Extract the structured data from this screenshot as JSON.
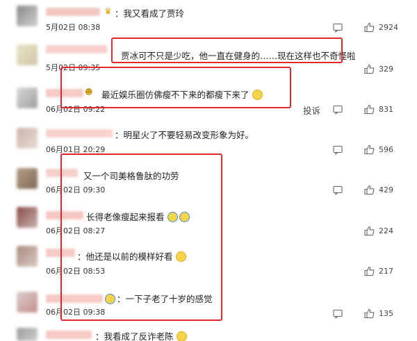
{
  "comments": [
    {
      "text": "：我又看成了贾玲",
      "time": "5月02日 08:38",
      "likes": "2924"
    },
    {
      "text": "贾冰可不只是少吃，他一直在健身的……现在这样也不奇怪啦",
      "time": "5月02日 09:35",
      "likes": "329"
    },
    {
      "text": "最近娱乐圈仿佛瘦不下来的都瘦下来了",
      "time": "06月02日 09:22",
      "likes": "831",
      "report": "投诉"
    },
    {
      "text": "：明星火了不要轻易改变形象为好。",
      "time": "06月01日 20:29",
      "likes": "596"
    },
    {
      "text": "又一个司美格鲁肽的功劳",
      "time": "06月02日 09:30",
      "likes": "429"
    },
    {
      "text": "长得老像瘦起来报看",
      "time": "06月02日 08:27",
      "likes": "224"
    },
    {
      "text": "：他还是以前的模样好看",
      "time": "06月02日 08:53",
      "likes": "217"
    },
    {
      "text": "：一下子老了十岁的感觉",
      "time": "06月02日 09:38",
      "likes": "135"
    },
    {
      "text": "：我看成了反诈老陈",
      "time": "",
      "likes": ""
    }
  ],
  "colors": {
    "highlight": "#e3262b",
    "blur_name": "#f6c9c4"
  },
  "icons": {
    "comment": "comment-icon",
    "like": "thumbs-up-icon",
    "emoji": "emoji-icon",
    "crown": "crown-icon"
  }
}
